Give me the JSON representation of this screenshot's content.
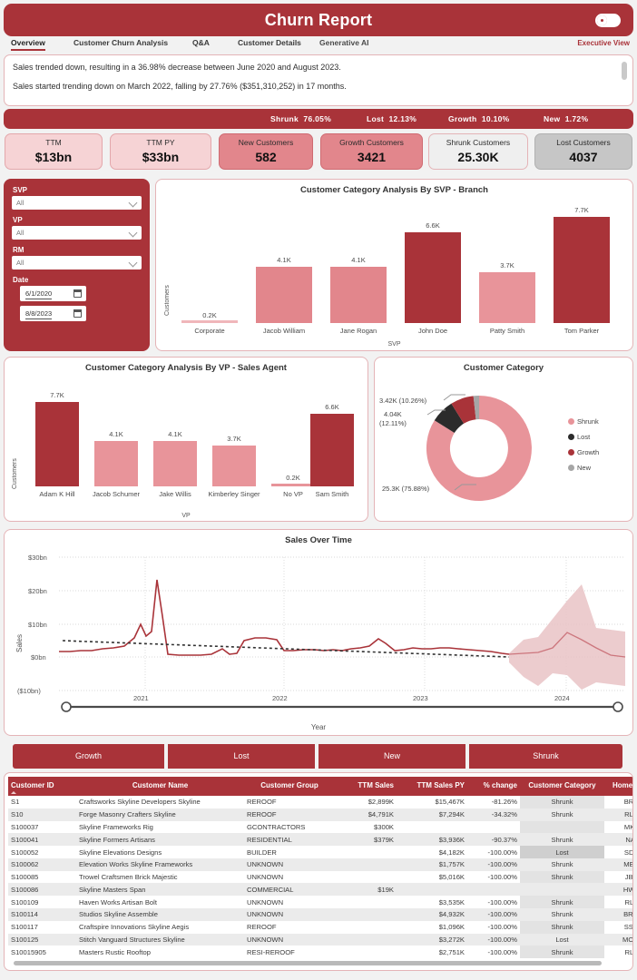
{
  "header": {
    "title": "Churn Report",
    "toggle_state": "on",
    "exec_view_label": "Executive View"
  },
  "tabs": [
    {
      "label": "Overview",
      "active": true
    },
    {
      "label": "Customer Churn Analysis",
      "active": false
    },
    {
      "label": "Q&A",
      "active": false
    },
    {
      "label": "Customer Details",
      "active": false
    },
    {
      "label": "Generative AI",
      "active": false
    }
  ],
  "narrative": {
    "line1": "Sales trended down, resulting in a 36.98% decrease between June 2020 and August 2023.",
    "line2": "Sales started trending down on March 2022, falling by 27.76% ($351,310,252) in 17 months."
  },
  "percent_strip": [
    {
      "label": "Shrunk",
      "value": "76.05%"
    },
    {
      "label": "Lost",
      "value": "12.13%"
    },
    {
      "label": "Growth",
      "value": "10.10%"
    },
    {
      "label": "New",
      "value": "1.72%"
    }
  ],
  "kpis": [
    {
      "label": "TTM",
      "value": "$13bn",
      "style": "pale"
    },
    {
      "label": "TTM PY",
      "value": "$33bn",
      "style": "pale"
    },
    {
      "label": "New Customers",
      "value": "582",
      "style": "mid"
    },
    {
      "label": "Growth Customers",
      "value": "3421",
      "style": "mid"
    },
    {
      "label": "Shrunk Customers",
      "value": "25.30K",
      "style": "white"
    },
    {
      "label": "Lost Customers",
      "value": "4037",
      "style": "gray"
    }
  ],
  "filters": {
    "svp": {
      "label": "SVP",
      "value": "All"
    },
    "vp": {
      "label": "VP",
      "value": "All"
    },
    "rm": {
      "label": "RM",
      "value": "All"
    },
    "date": {
      "label": "Date",
      "from": "6/1/2020",
      "to": "8/8/2023"
    }
  },
  "colors": {
    "brand": "#a93339",
    "bar_dark": "#a93339",
    "bar_light": "#e2868c",
    "bar_pale": "#f0b6ba",
    "lost": "#2b2b2b",
    "new": "#a6a6a6",
    "shrunk": "#e8949a"
  },
  "chart_data": [
    {
      "type": "bar",
      "title": "Customer Category Analysis By SVP - Branch",
      "xlabel": "SVP",
      "ylabel": "Customers",
      "categories": [
        "Corporate",
        "Jacob William",
        "Jane Rogan",
        "John Doe",
        "Patty Smith",
        "Tom Parker"
      ],
      "values": [
        0.2,
        4.1,
        4.1,
        6.6,
        3.7,
        7.7
      ],
      "labels": [
        "0.2K",
        "4.1K",
        "4.1K",
        "6.6K",
        "3.7K",
        "7.7K"
      ],
      "bar_colors": [
        "#f0b6ba",
        "#e2868c",
        "#e2868c",
        "#a93339",
        "#e8949a",
        "#a93339"
      ],
      "ylim": [
        0,
        8.2
      ],
      "grid": false
    },
    {
      "type": "bar",
      "title": "Customer Category Analysis By VP - Sales Agent",
      "xlabel": "VP",
      "ylabel": "Customers",
      "categories": [
        "Adam K Hill",
        "Jacob Schumer",
        "Jake Willis",
        "Kimberley Singer",
        "No VP",
        "Sam Smith"
      ],
      "values": [
        7.7,
        4.1,
        4.1,
        3.7,
        0.2,
        6.6
      ],
      "labels": [
        "7.7K",
        "4.1K",
        "4.1K",
        "3.7K",
        "0.2K",
        "6.6K"
      ],
      "bar_colors": [
        "#a93339",
        "#e8949a",
        "#e8949a",
        "#e8949a",
        "#e8949a",
        "#a93339"
      ],
      "ylim": [
        0,
        8.2
      ],
      "grid": false
    },
    {
      "type": "pie",
      "title": "Customer Category",
      "legend_position": "right",
      "categories": [
        "Shrunk",
        "Lost",
        "Growth",
        "New"
      ],
      "values": [
        25.3,
        4.04,
        3.42,
        0.58
      ],
      "percents": [
        "75.88%",
        "12.11%",
        "10.26%",
        "1.72%"
      ],
      "slice_labels": [
        "25.3K (75.88%)",
        "4.04K\n(12.11%)",
        "3.42K (10.26%)",
        ""
      ],
      "slice_colors": [
        "#e8949a",
        "#2b2b2b",
        "#a93339",
        "#a6a6a6"
      ]
    },
    {
      "type": "line",
      "title": "Sales Over Time",
      "xlabel": "Year",
      "ylabel": "Sales",
      "yticks": [
        "$30bn",
        "$20bn",
        "$10bn",
        "$0bn",
        "($10bn)"
      ],
      "xticks": [
        "2021",
        "2022",
        "2023",
        "2024"
      ],
      "ylim": [
        -10,
        33
      ],
      "grid": true,
      "series": [
        {
          "name": "Sales",
          "color": "#a93339"
        },
        {
          "name": "Trend",
          "color": "#333333",
          "style": "dotted"
        },
        {
          "name": "Forecast",
          "color": "#d98f95",
          "style": "band"
        }
      ]
    }
  ],
  "donut_labels": {
    "shrunk": "25.3K (75.88%)",
    "lost_l1": "4.04K",
    "lost_l2": "(12.11%)",
    "growth": "3.42K (10.26%)"
  },
  "category_buttons": [
    "Growth",
    "Lost",
    "New",
    "Shrunk"
  ],
  "table": {
    "columns": [
      "Customer ID",
      "Customer Name",
      "Customer Group",
      "TTM Sales",
      "TTM Sales PY",
      "% change",
      "Customer Category",
      "Home Branch"
    ],
    "sorted_column": "Customer ID",
    "sort_direction": "asc",
    "rows": [
      {
        "id": "S1",
        "name": "Craftsworks Skyline Developers Skyline",
        "group": "REROOF",
        "ttm": "$2,899K",
        "ttm_py": "$15,467K",
        "change": "-81.26%",
        "category": "Shrunk",
        "branch": "BRBUR"
      },
      {
        "id": "S10",
        "name": "Forge Masonry Crafters Skyline",
        "group": "REROOF",
        "ttm": "$4,791K",
        "ttm_py": "$7,294K",
        "change": "-34.32%",
        "category": "Shrunk",
        "branch": "RLSUN"
      },
      {
        "id": "S100037",
        "name": "Skyline Frameworks Rig",
        "group": "GCONTRACTORS",
        "ttm": "$300K",
        "ttm_py": "",
        "change": "",
        "category": "",
        "branch": "MKFAR"
      },
      {
        "id": "S100041",
        "name": "Skyline Formers Artisans",
        "group": "RESIDENTIAL",
        "ttm": "$379K",
        "ttm_py": "$3,936K",
        "change": "-90.37%",
        "category": "Shrunk",
        "branch": "NABRI"
      },
      {
        "id": "S100052",
        "name": "Skyline Elevations Designs",
        "group": "BUILDER",
        "ttm": "",
        "ttm_py": "$4,182K",
        "change": "-100.00%",
        "category": "Lost",
        "branch": "SDNAS"
      },
      {
        "id": "S100062",
        "name": "Elevation Works Skyline Frameworks",
        "group": "UNKNOWN",
        "ttm": "",
        "ttm_py": "$1,757K",
        "change": "-100.00%",
        "category": "Shrunk",
        "branch": "MEDAN"
      },
      {
        "id": "S100085",
        "name": "Trowel Craftsmen Brick Majestic",
        "group": "UNKNOWN",
        "ttm": "",
        "ttm_py": "$5,016K",
        "change": "-100.00%",
        "category": "Shrunk",
        "branch": "JBANA"
      },
      {
        "id": "S100086",
        "name": "Skyline Masters Span",
        "group": "COMMERCIAL",
        "ttm": "$19K",
        "ttm_py": "",
        "change": "",
        "category": "",
        "branch": "HWMAL"
      },
      {
        "id": "S100109",
        "name": "Haven Works Artisan Bolt",
        "group": "UNKNOWN",
        "ttm": "",
        "ttm_py": "$3,535K",
        "change": "-100.00%",
        "category": "Shrunk",
        "branch": "RLAZU"
      },
      {
        "id": "S100114",
        "name": "Studios Skyline Assemble",
        "group": "UNKNOWN",
        "ttm": "",
        "ttm_py": "$4,932K",
        "change": "-100.00%",
        "category": "Shrunk",
        "branch": "BRPOM"
      },
      {
        "id": "S100117",
        "name": "Craftspire Innovations Skyline Aegis",
        "group": "REROOF",
        "ttm": "",
        "ttm_py": "$1,096K",
        "change": "-100.00%",
        "category": "Shrunk",
        "branch": "SSWYL"
      },
      {
        "id": "S100125",
        "name": "Stitch Vanguard Structures Skyline",
        "group": "UNKNOWN",
        "ttm": "",
        "ttm_py": "$3,272K",
        "change": "-100.00%",
        "category": "Lost",
        "branch": "MOMON"
      },
      {
        "id": "S10015905",
        "name": "Masters Rustic Rooftop",
        "group": "RESI-REROOF",
        "ttm": "",
        "ttm_py": "$2,751K",
        "change": "-100.00%",
        "category": "Shrunk",
        "branch": "RLFRE"
      }
    ]
  }
}
